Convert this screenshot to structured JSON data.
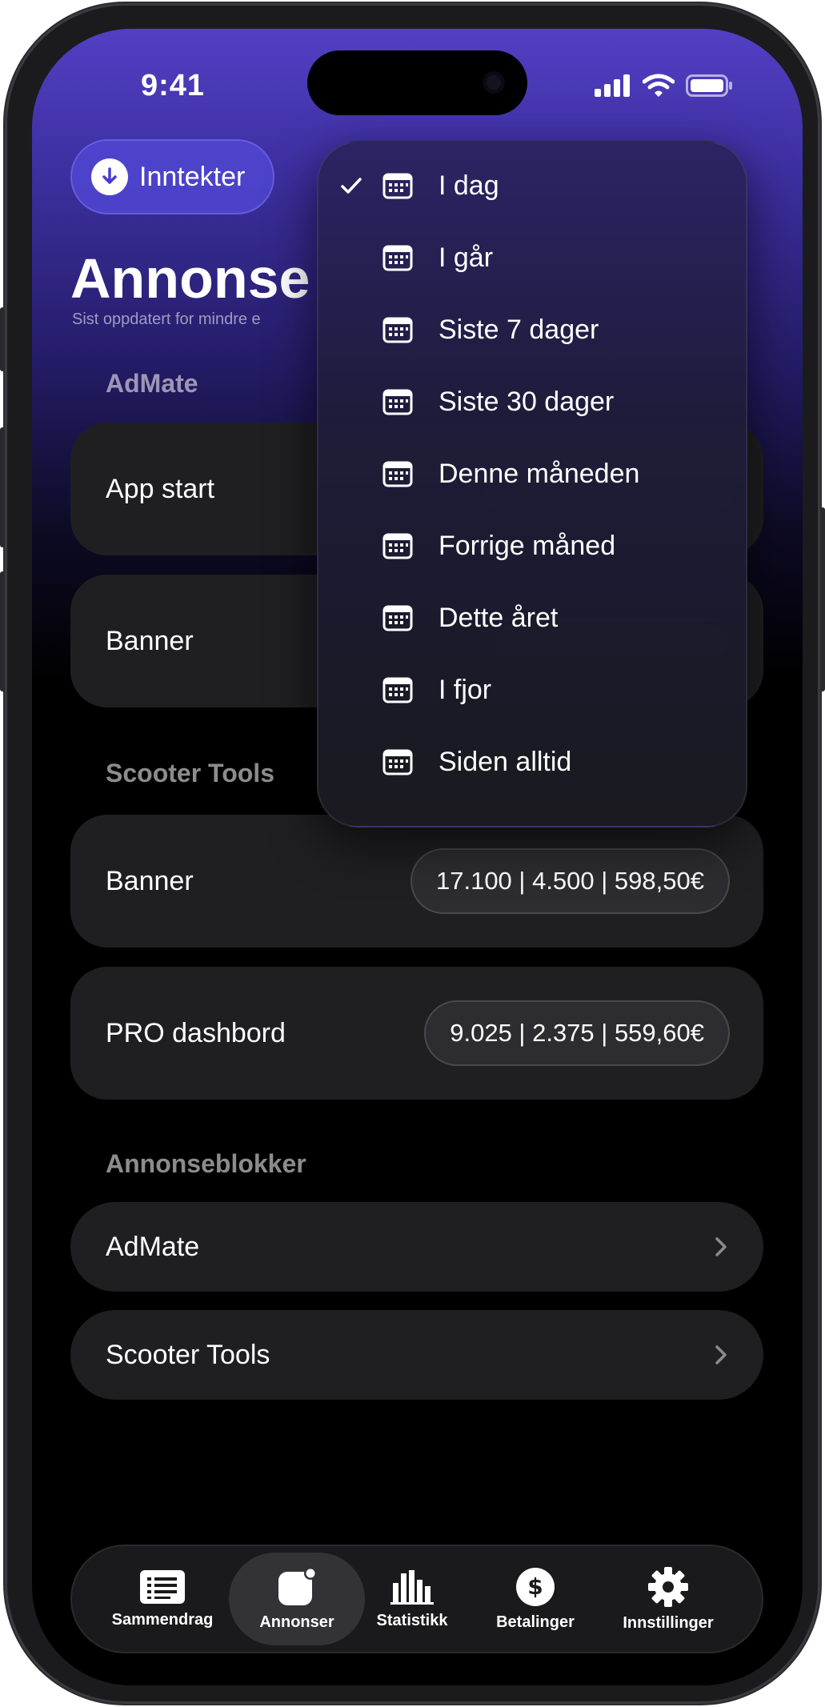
{
  "status_bar": {
    "time": "9:41"
  },
  "header": {
    "income_button": "Inntekter",
    "title": "Annonse",
    "subtitle": "Sist oppdatert for mindre e"
  },
  "sections": [
    {
      "title": "AdMate",
      "items": [
        {
          "label": "App start",
          "value": ""
        },
        {
          "label": "Banner",
          "value": ""
        }
      ]
    },
    {
      "title": "Scooter Tools",
      "items": [
        {
          "label": "Banner",
          "value": "17.100 | 4.500 | 598,50€"
        },
        {
          "label": "PRO dashbord",
          "value": "9.025 | 2.375 | 559,60€"
        }
      ]
    }
  ],
  "ad_blocks": {
    "title": "Annonseblokker",
    "items": [
      {
        "label": "AdMate"
      },
      {
        "label": "Scooter Tools"
      }
    ]
  },
  "date_menu": {
    "selected_index": 0,
    "options": [
      "I dag",
      "I går",
      "Siste 7 dager",
      "Siste 30 dager",
      "Denne måneden",
      "Forrige måned",
      "Dette året",
      "I fjor",
      "Siden alltid"
    ]
  },
  "tab_bar": {
    "active_index": 1,
    "tabs": [
      {
        "label": "Sammendrag",
        "icon": "list-icon"
      },
      {
        "label": "Annonser",
        "icon": "ads-icon"
      },
      {
        "label": "Statistikk",
        "icon": "chart-icon"
      },
      {
        "label": "Betalinger",
        "icon": "dollar-icon"
      },
      {
        "label": "Innstillinger",
        "icon": "gear-icon"
      }
    ]
  },
  "colors": {
    "accent": "#5140c4",
    "card": "#1f1f22",
    "background": "#000000"
  }
}
